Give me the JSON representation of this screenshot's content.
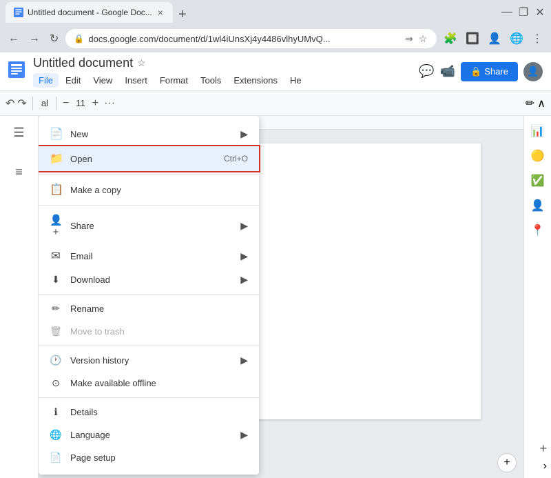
{
  "browser": {
    "tab_title": "Untitled document - Google Doc...",
    "tab_close": "×",
    "new_tab": "+",
    "url": "docs.google.com/document/d/1wl4iUnsXj4y4486vlhyUMvQ...",
    "window_minimize": "—",
    "window_restore": "❐",
    "window_close": "✕"
  },
  "appbar": {
    "title": "Untitled document",
    "share_label": "Share",
    "share_icon": "🔒",
    "menu_items": [
      "File",
      "Edit",
      "View",
      "Insert",
      "Format",
      "Tools",
      "Extensions",
      "He"
    ]
  },
  "toolbar": {
    "undo": "↶",
    "redo": "↷",
    "font_label": "al",
    "minus": "−",
    "font_size": "11",
    "plus": "+",
    "more": "···",
    "edit_icon": "✏",
    "collapse": "∧"
  },
  "context_menu": {
    "sections": [
      {
        "items": [
          {
            "icon": "📄",
            "label": "New",
            "has_arrow": true,
            "shortcut": "",
            "disabled": false,
            "highlighted": false
          },
          {
            "icon": "📁",
            "label": "Open",
            "has_arrow": false,
            "shortcut": "Ctrl+O",
            "disabled": false,
            "highlighted": true
          }
        ]
      },
      {
        "items": [
          {
            "icon": "📋",
            "label": "Make a copy",
            "has_arrow": false,
            "shortcut": "",
            "disabled": false,
            "highlighted": false
          }
        ]
      },
      {
        "items": [
          {
            "icon": "👤",
            "label": "Share",
            "has_arrow": true,
            "shortcut": "",
            "disabled": false,
            "highlighted": false
          },
          {
            "icon": "✉",
            "label": "Email",
            "has_arrow": true,
            "shortcut": "",
            "disabled": false,
            "highlighted": false
          },
          {
            "icon": "⬇",
            "label": "Download",
            "has_arrow": true,
            "shortcut": "",
            "disabled": false,
            "highlighted": false
          }
        ]
      },
      {
        "items": [
          {
            "icon": "✏",
            "label": "Rename",
            "has_arrow": false,
            "shortcut": "",
            "disabled": false,
            "highlighted": false
          },
          {
            "icon": "🗑",
            "label": "Move to trash",
            "has_arrow": false,
            "shortcut": "",
            "disabled": true,
            "highlighted": false
          }
        ]
      },
      {
        "items": [
          {
            "icon": "🕐",
            "label": "Version history",
            "has_arrow": true,
            "shortcut": "",
            "disabled": false,
            "highlighted": false
          },
          {
            "icon": "⊙",
            "label": "Make available offline",
            "has_arrow": false,
            "shortcut": "",
            "disabled": false,
            "highlighted": false
          }
        ]
      },
      {
        "items": [
          {
            "icon": "ℹ",
            "label": "Details",
            "has_arrow": false,
            "shortcut": "",
            "disabled": false,
            "highlighted": false
          },
          {
            "icon": "🌐",
            "label": "Language",
            "has_arrow": true,
            "shortcut": "",
            "disabled": false,
            "highlighted": false
          },
          {
            "icon": "📄",
            "label": "Page setup",
            "has_arrow": false,
            "shortcut": "",
            "disabled": false,
            "highlighted": false
          }
        ]
      }
    ]
  },
  "right_sidebar": {
    "icons": [
      "📊",
      "🟡",
      "✅",
      "👤",
      "📍"
    ]
  }
}
